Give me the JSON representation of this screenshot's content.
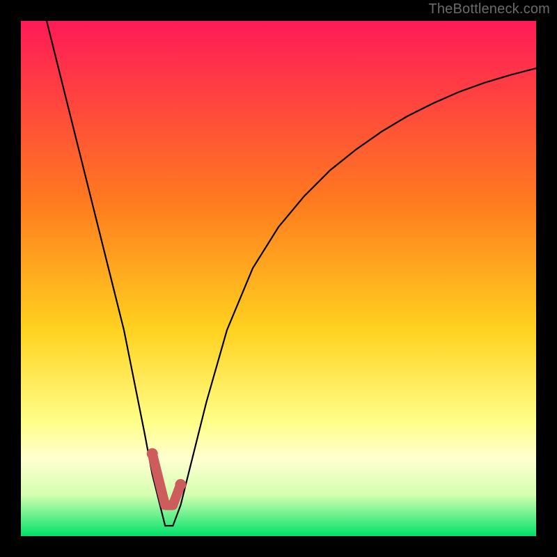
{
  "watermark": "TheBottleneck.com",
  "colors": {
    "bg": "#000000",
    "grad_top": "#ff1a58",
    "grad_mid1": "#ff7a1f",
    "grad_mid2": "#ffd21f",
    "grad_mid3": "#ffff8a",
    "grad_band": "#ffffd0",
    "grad_green": "#00e26a",
    "curve": "#000000",
    "highlight": "#cd5c5c"
  },
  "chart_data": {
    "type": "line",
    "title": "",
    "xlabel": "",
    "ylabel": "",
    "xlim": [
      0,
      100
    ],
    "ylim": [
      0,
      100
    ],
    "curve_x": [
      5,
      8,
      11,
      14,
      17,
      20,
      22,
      24,
      25.5,
      27,
      28,
      29.5,
      31,
      33,
      36,
      40,
      45,
      50,
      55,
      60,
      65,
      70,
      75,
      80,
      85,
      90,
      95,
      100
    ],
    "curve_y": [
      100,
      88,
      76,
      64,
      52,
      40,
      30,
      20,
      12,
      6,
      2,
      2,
      6,
      14,
      26,
      40,
      52,
      60,
      66,
      71,
      75,
      78.5,
      81.5,
      84,
      86.2,
      88,
      89.5,
      90.8
    ],
    "highlight_band": {
      "x_start": 25.5,
      "x_end": 31,
      "y_top_delta": 4,
      "note": "short salmon U-shaped segment near bottom of valley"
    },
    "gradient_stops_pct": [
      {
        "y": 0,
        "color": "#ff1a58"
      },
      {
        "y": 35,
        "color": "#ff7a1f"
      },
      {
        "y": 60,
        "color": "#ffd21f"
      },
      {
        "y": 78,
        "color": "#ffff8a"
      },
      {
        "y": 85,
        "color": "#ffffd0"
      },
      {
        "y": 92,
        "color": "#d4ffb0"
      },
      {
        "y": 100,
        "color": "#00e26a"
      }
    ]
  }
}
